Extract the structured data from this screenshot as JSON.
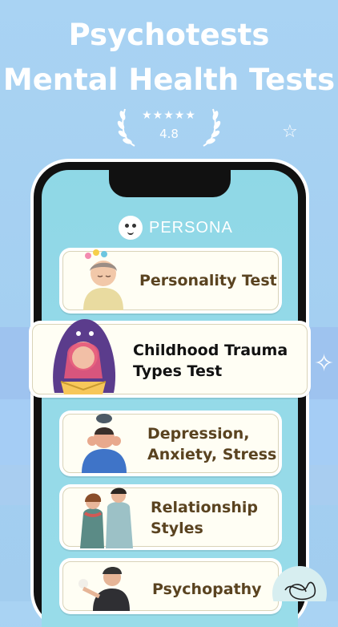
{
  "header": {
    "line1": "Psychotests",
    "line2": "Mental Health Tests",
    "stars": "★★★★★",
    "rating": "4.8"
  },
  "app": {
    "brand": "PERSONA"
  },
  "tests": [
    {
      "label": "Personality Test"
    },
    {
      "label_line1": "Childhood Trauma",
      "label_line2": "Types Test"
    },
    {
      "label_line1": "Depression,",
      "label_line2": "Anxiety, Stress"
    },
    {
      "label_line1": "Relationship",
      "label_line2": "Styles"
    },
    {
      "label": "Psychopathy"
    }
  ],
  "colors": {
    "background": "#a6d0f1",
    "screen": "#94d9e8",
    "card_text": "#5a4320",
    "highlight_text": "#111111"
  },
  "icons": [
    "laurel-left-icon",
    "laurel-right-icon",
    "sparkle-icon",
    "persona-logo-icon"
  ]
}
